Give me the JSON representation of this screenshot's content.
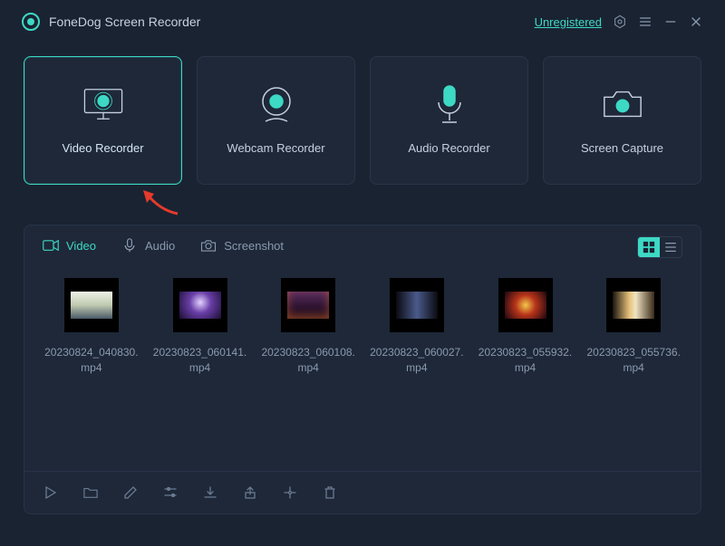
{
  "header": {
    "app_title": "FoneDog Screen Recorder",
    "unregistered_label": "Unregistered"
  },
  "modes": [
    {
      "id": "video",
      "label": "Video Recorder",
      "active": true
    },
    {
      "id": "webcam",
      "label": "Webcam Recorder",
      "active": false
    },
    {
      "id": "audio",
      "label": "Audio Recorder",
      "active": false
    },
    {
      "id": "capture",
      "label": "Screen Capture",
      "active": false
    }
  ],
  "tabs": {
    "video": "Video",
    "audio": "Audio",
    "screenshot": "Screenshot",
    "active": "video"
  },
  "view": "grid",
  "files": [
    {
      "name": "20230824_040830.mp4",
      "thumb": "t1"
    },
    {
      "name": "20230823_060141.mp4",
      "thumb": "t2"
    },
    {
      "name": "20230823_060108.mp4",
      "thumb": "t3"
    },
    {
      "name": "20230823_060027.mp4",
      "thumb": "t4"
    },
    {
      "name": "20230823_055932.mp4",
      "thumb": "t5"
    },
    {
      "name": "20230823_055736.mp4",
      "thumb": "t6"
    }
  ],
  "toolbar_icons": [
    "play",
    "folder",
    "edit",
    "settings-sliders",
    "save",
    "export",
    "clip",
    "delete"
  ],
  "colors": {
    "accent": "#3dd9c5",
    "bg": "#1a2332",
    "panel": "#1e2838"
  }
}
